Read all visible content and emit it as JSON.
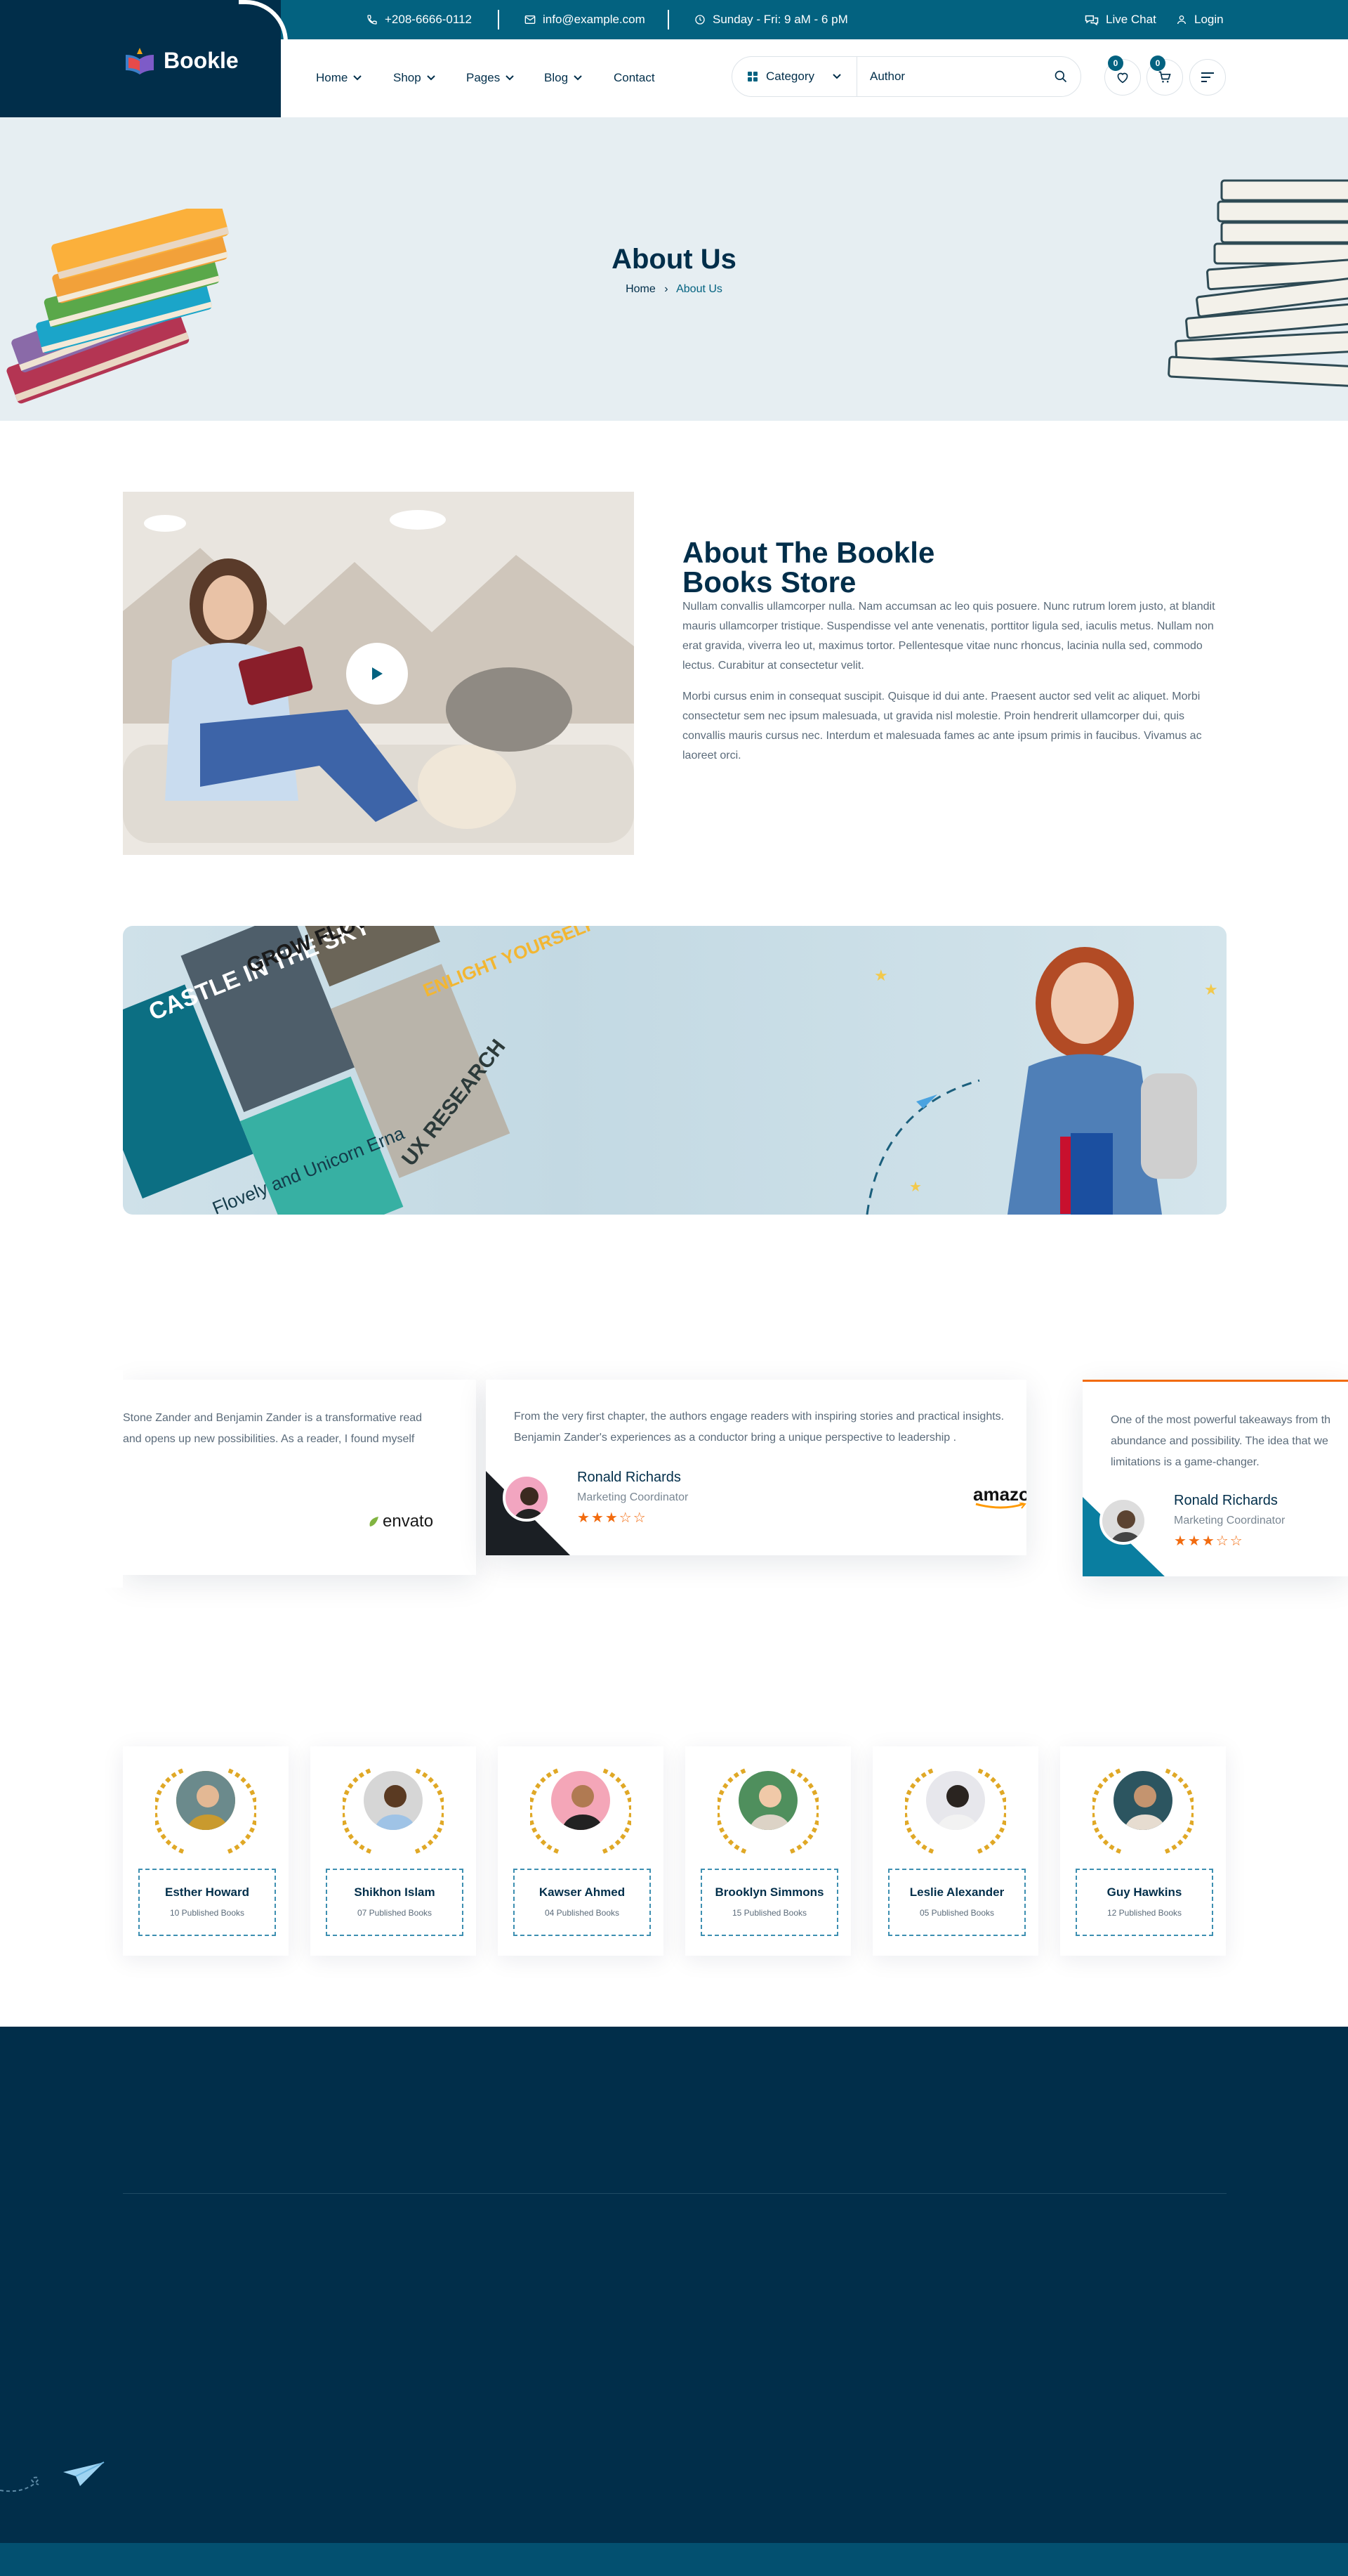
{
  "topbar": {
    "phone": "+208-6666-0112",
    "email": "info@example.com",
    "hours": "Sunday - Fri: 9 aM - 6 pM",
    "live_chat": "Live Chat",
    "login": "Login"
  },
  "brand": {
    "name": "Bookle"
  },
  "nav": {
    "home": "Home",
    "shop": "Shop",
    "pages": "Pages",
    "blog": "Blog",
    "contact": "Contact"
  },
  "search": {
    "category": "Category",
    "placeholder": "Author"
  },
  "header_icons": {
    "wishlist_count": "0",
    "cart_count": "0"
  },
  "hero": {
    "title": "About Us",
    "breadcrumb_home": "Home",
    "breadcrumb_sep": "›",
    "breadcrumb_current": "About Us"
  },
  "about": {
    "heading_line1": "About The Bookle",
    "heading_line2": "Books Store",
    "para1": "Nullam convallis ullamcorper nulla. Nam accumsan ac leo quis posuere. Nunc rutrum lorem justo, at blandit mauris ullamcorper tristique. Suspendisse vel ante venenatis, porttitor ligula sed, iaculis metus. Nullam non erat gravida, viverra leo ut, maximus tortor. Pellentesque vitae nunc rhoncus, lacinia nulla sed, commodo lectus. Curabitur at consectetur velit.",
    "para2": "Morbi cursus enim in consequat suscipit. Quisque id dui ante. Praesent auctor sed velit ac aliquet. Morbi consectetur sem nec ipsum malesuada, ut gravida nisl molestie. Proin hendrerit ullamcorper dui, quis convallis mauris cursus nec. Interdum et malesuada fames ac ante ipsum primis in faucibus. Vivamus ac laoreet orci."
  },
  "promo": {
    "book1": "CASTLE IN THE SKY",
    "book2": "GROW FLOWER",
    "book3": "ENLIGHT YOURSELF",
    "book4": "UX RESEARCH",
    "book5": "Flovely and Unicorn Erna"
  },
  "testimonials": [
    {
      "quote": "Stone Zander and Benjamin Zander is a transformative read and opens up new possibilities. As a reader, I found myself",
      "logo": "envato"
    },
    {
      "quote": "From the very first chapter, the authors engage readers with inspiring stories and practical insights. Benjamin Zander's experiences as a conductor bring a unique perspective to leadership .",
      "name": "Ronald Richards",
      "role": "Marketing Coordinator",
      "rating": 3,
      "stars": "★★★☆☆",
      "logo": "amazon"
    },
    {
      "quote": "One of the most powerful takeaways from th abundance and possibility. The idea that we limitations is a game-changer.",
      "name": "Ronald Richards",
      "role": "Marketing Coordinator",
      "rating": 3,
      "stars": "★★★☆☆"
    }
  ],
  "authors": [
    {
      "name": "Esther Howard",
      "books": "10 Published Books"
    },
    {
      "name": "Shikhon Islam",
      "books": "07 Published Books"
    },
    {
      "name": "Kawser Ahmed",
      "books": "04 Published Books"
    },
    {
      "name": "Brooklyn Simmons",
      "books": "15 Published Books"
    },
    {
      "name": "Leslie Alexander",
      "books": "05 Published Books"
    },
    {
      "name": "Guy Hawkins",
      "books": "12 Published Books"
    }
  ],
  "colors": {
    "primary": "#036280",
    "navy": "#012e4a",
    "accent": "#f26b0f",
    "hero_bg": "#e6eef2"
  }
}
